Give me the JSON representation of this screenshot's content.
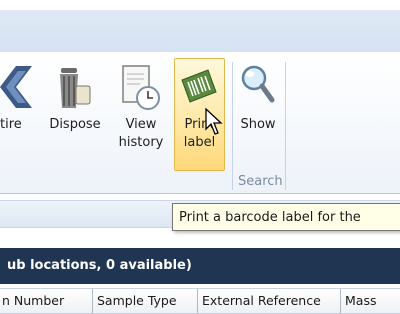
{
  "ribbon": {
    "buttons": {
      "retire": {
        "label": "tire"
      },
      "dispose": {
        "label": "Dispose"
      },
      "view_history": {
        "line1": "View",
        "line2": "history"
      },
      "print_label": {
        "line1": "Print",
        "line2": "label"
      },
      "show": {
        "label": "Show"
      }
    },
    "groups": {
      "search": "Search"
    }
  },
  "tooltip": {
    "text": "Print a barcode label for the"
  },
  "grid": {
    "header_text": "ub locations, 0 available)",
    "columns": [
      "n Number",
      "Sample Type",
      "External Reference",
      "Mass"
    ]
  },
  "colors": {
    "header_band": "#1f3552",
    "hover": "#ffe9a8",
    "ribbon": "#dfe9f5"
  },
  "icons": [
    "retire-arrow-icon",
    "trash-can-icon",
    "history-icon",
    "barcode-icon",
    "magnifier-icon",
    "mouse-pointer-icon"
  ]
}
